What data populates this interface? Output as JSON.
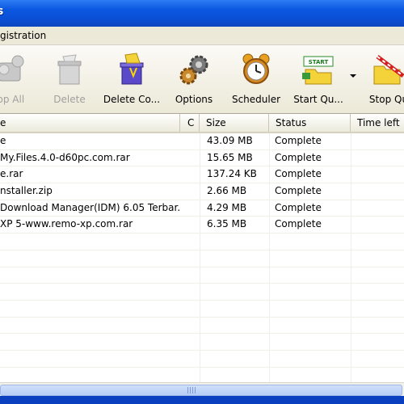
{
  "window": {
    "title_fragment": "s"
  },
  "menu": {
    "items": [
      "gistration"
    ]
  },
  "toolbar": {
    "buttons": [
      {
        "label": "top All",
        "icon": "stop-all-icon",
        "enabled": false
      },
      {
        "label": "Delete",
        "icon": "delete-icon",
        "enabled": false
      },
      {
        "label": "Delete Co...",
        "icon": "delete-completed-icon",
        "enabled": true
      },
      {
        "label": "Options",
        "icon": "gear-icon",
        "enabled": true
      },
      {
        "label": "Scheduler",
        "icon": "alarm-clock-icon",
        "enabled": true
      },
      {
        "label": "Start Qu...",
        "icon": "start-queue-icon",
        "enabled": true
      },
      {
        "label": "Stop Qu",
        "icon": "stop-queue-icon",
        "enabled": true
      }
    ]
  },
  "list": {
    "columns": [
      "e",
      "C",
      "Size",
      "Status",
      "Time left"
    ],
    "rows": [
      {
        "name": "e",
        "size": "43.09  MB",
        "status": "Complete"
      },
      {
        "name": "My.Files.4.0-d60pc.com.rar",
        "size": "15.65  MB",
        "status": "Complete"
      },
      {
        "name": "e.rar",
        "size": "137.24  KB",
        "status": "Complete"
      },
      {
        "name": "nstaller.zip",
        "size": "2.66  MB",
        "status": "Complete"
      },
      {
        "name": "Download Manager(IDM) 6.05 Terbar...",
        "size": "4.29  MB",
        "status": "Complete"
      },
      {
        "name": "XP 5-www.remo-xp.com.rar",
        "size": "6.35  MB",
        "status": "Complete"
      }
    ],
    "empty_row_count": 10
  },
  "colors": {
    "title_bar": "#0a4fd6",
    "chrome": "#ece9d8"
  }
}
